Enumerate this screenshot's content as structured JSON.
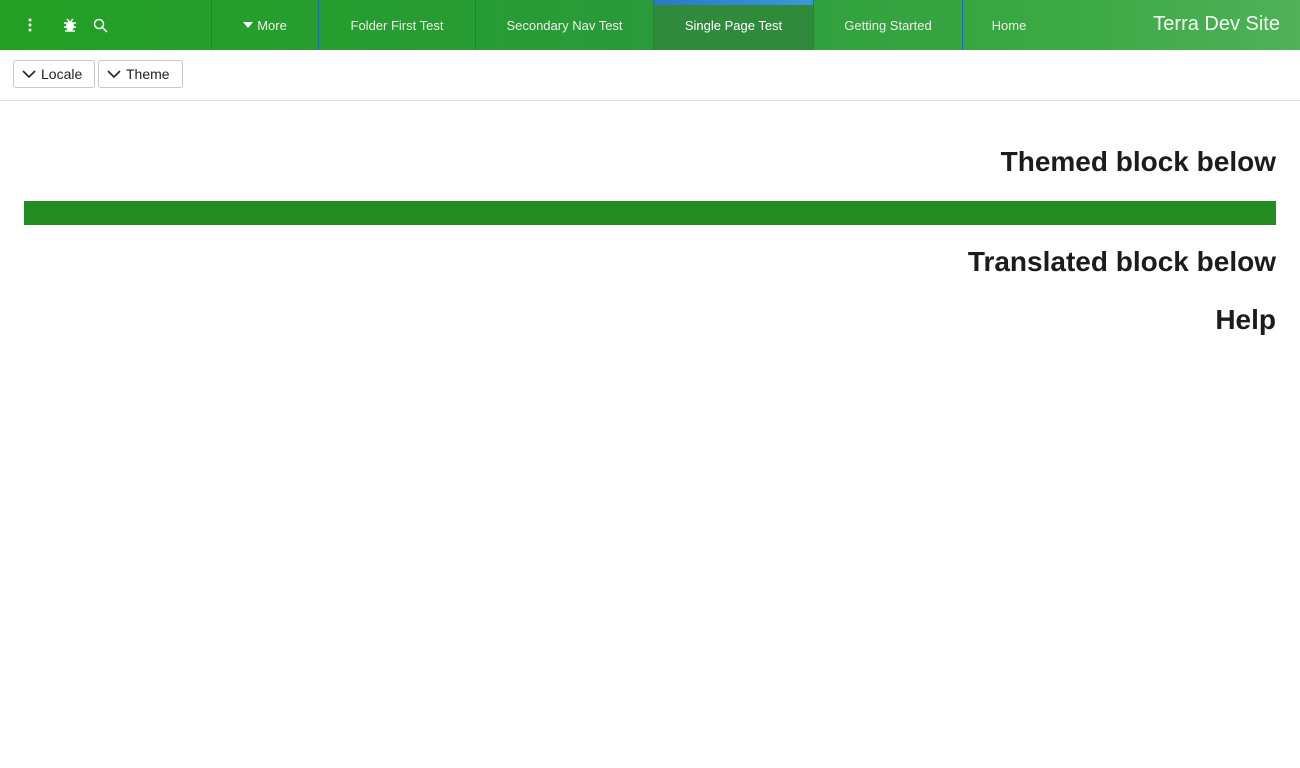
{
  "header": {
    "site_title": "Terra Dev Site",
    "icons": [
      "more-vertical-icon",
      "bug-icon",
      "search-icon"
    ],
    "nav": [
      {
        "label": "More",
        "has_caret": true,
        "active": false
      },
      {
        "label": "Folder First Test",
        "active": false
      },
      {
        "label": "Secondary Nav Test",
        "active": false
      },
      {
        "label": "Single Page Test",
        "active": true
      },
      {
        "label": "Getting Started",
        "active": false
      },
      {
        "label": "Home",
        "active": false
      }
    ]
  },
  "toolbar": {
    "locale_label": "Locale",
    "theme_label": "Theme"
  },
  "main": {
    "themed_heading": "Themed block below",
    "translated_heading": "Translated block below",
    "help_heading": "Help"
  },
  "colors": {
    "header_green": "#23a023",
    "themed_block": "#228b22",
    "active_tab_indicator": "#2a78c8"
  }
}
